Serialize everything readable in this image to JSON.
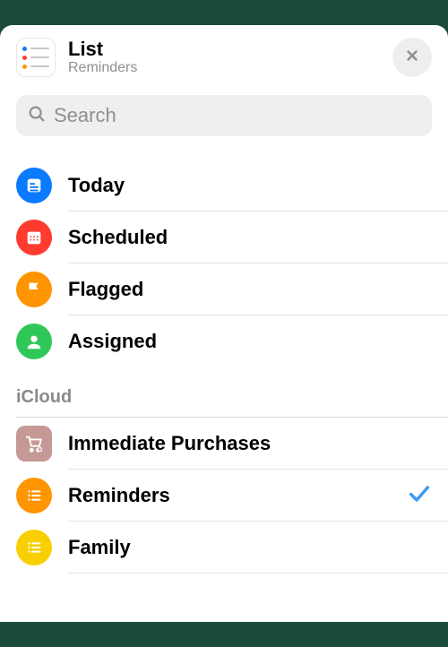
{
  "header": {
    "title": "List",
    "subtitle": "Reminders"
  },
  "search": {
    "placeholder": "Search",
    "value": ""
  },
  "smartLists": [
    {
      "label": "Today",
      "icon": "today",
      "color": "#0a7aff"
    },
    {
      "label": "Scheduled",
      "icon": "scheduled",
      "color": "#ff3b30"
    },
    {
      "label": "Flagged",
      "icon": "flagged",
      "color": "#ff9500"
    },
    {
      "label": "Assigned",
      "icon": "assigned",
      "color": "#30c759"
    }
  ],
  "sections": [
    {
      "title": "iCloud",
      "lists": [
        {
          "label": "Immediate Purchases",
          "icon": "cart",
          "color": "#c59996",
          "selected": false
        },
        {
          "label": "Reminders",
          "icon": "list",
          "color": "#ff9500",
          "selected": true
        },
        {
          "label": "Family",
          "icon": "list",
          "color": "#f8cf00",
          "selected": false
        }
      ]
    }
  ],
  "colors": {
    "checkmark": "#3e9cf3"
  }
}
